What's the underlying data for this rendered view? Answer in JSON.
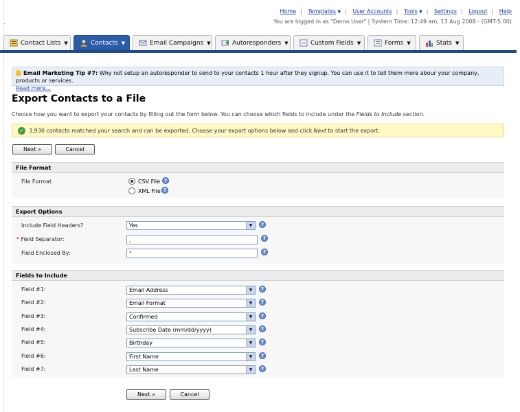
{
  "topnav": {
    "links": [
      "Home",
      "Templates",
      "User Accounts",
      "Tools",
      "Settings",
      "Logout",
      "Help"
    ],
    "status": "You are logged in as \"Demo User\" | System Time: 12:49 am, 13 Aug 2008 - (GMT-5:00)"
  },
  "tabs": [
    {
      "label": "Contact Lists",
      "icon": "contact-lists-icon",
      "active": false
    },
    {
      "label": "Contacts",
      "icon": "contacts-icon",
      "active": true
    },
    {
      "label": "Email Campaigns",
      "icon": "email-icon",
      "active": false
    },
    {
      "label": "Autoresponders",
      "icon": "autoresponder-icon",
      "active": false
    },
    {
      "label": "Custom Fields",
      "icon": "custom-fields-icon",
      "active": false
    },
    {
      "label": "Forms",
      "icon": "forms-icon",
      "active": false
    },
    {
      "label": "Stats",
      "icon": "stats-icon",
      "active": false
    }
  ],
  "tip": {
    "title": "Email Marketing Tip #7:",
    "text": "Why not setup an autoresponder to send to your contacts 1 hour after they signup. You can use it to tell them more abour your company, products or services.",
    "link": "Read more..."
  },
  "page": {
    "title": "Export Contacts to a File",
    "intro_prefix": "Choose how you want to export your contacts by filling out the form below. You can choose which fields to include under the ",
    "intro_em": "Fields to Include",
    "intro_suffix": " section."
  },
  "success": {
    "prefix": "3,930 contacts matched your search and can be exported. Choose your export options below and click ",
    "em": "Next",
    "suffix": " to start the export."
  },
  "buttons": {
    "next": "Next »",
    "cancel": "Cancel"
  },
  "file_format": {
    "section": "File Format",
    "label": "File Format",
    "options": [
      "CSV File",
      "XML File"
    ],
    "selected": "CSV File"
  },
  "export_options": {
    "section": "Export Options",
    "headers_label": "Include Field Headers?",
    "headers_value": "Yes",
    "separator_label": "Field Separator:",
    "separator_value": ",",
    "enclosed_label": "Field Enclosed By:",
    "enclosed_value": "\""
  },
  "fields": {
    "section": "Fields to Include",
    "rows": [
      {
        "label": "Field #1:",
        "value": "Email Address"
      },
      {
        "label": "Field #2:",
        "value": "Email Format"
      },
      {
        "label": "Field #3:",
        "value": "Confirmed"
      },
      {
        "label": "Field #4:",
        "value": "Subscribe Date (mm/dd/yyyy)"
      },
      {
        "label": "Field #5:",
        "value": "Birthday"
      },
      {
        "label": "Field #6:",
        "value": "First Name"
      },
      {
        "label": "Field #7:",
        "value": "Last Name"
      }
    ]
  }
}
